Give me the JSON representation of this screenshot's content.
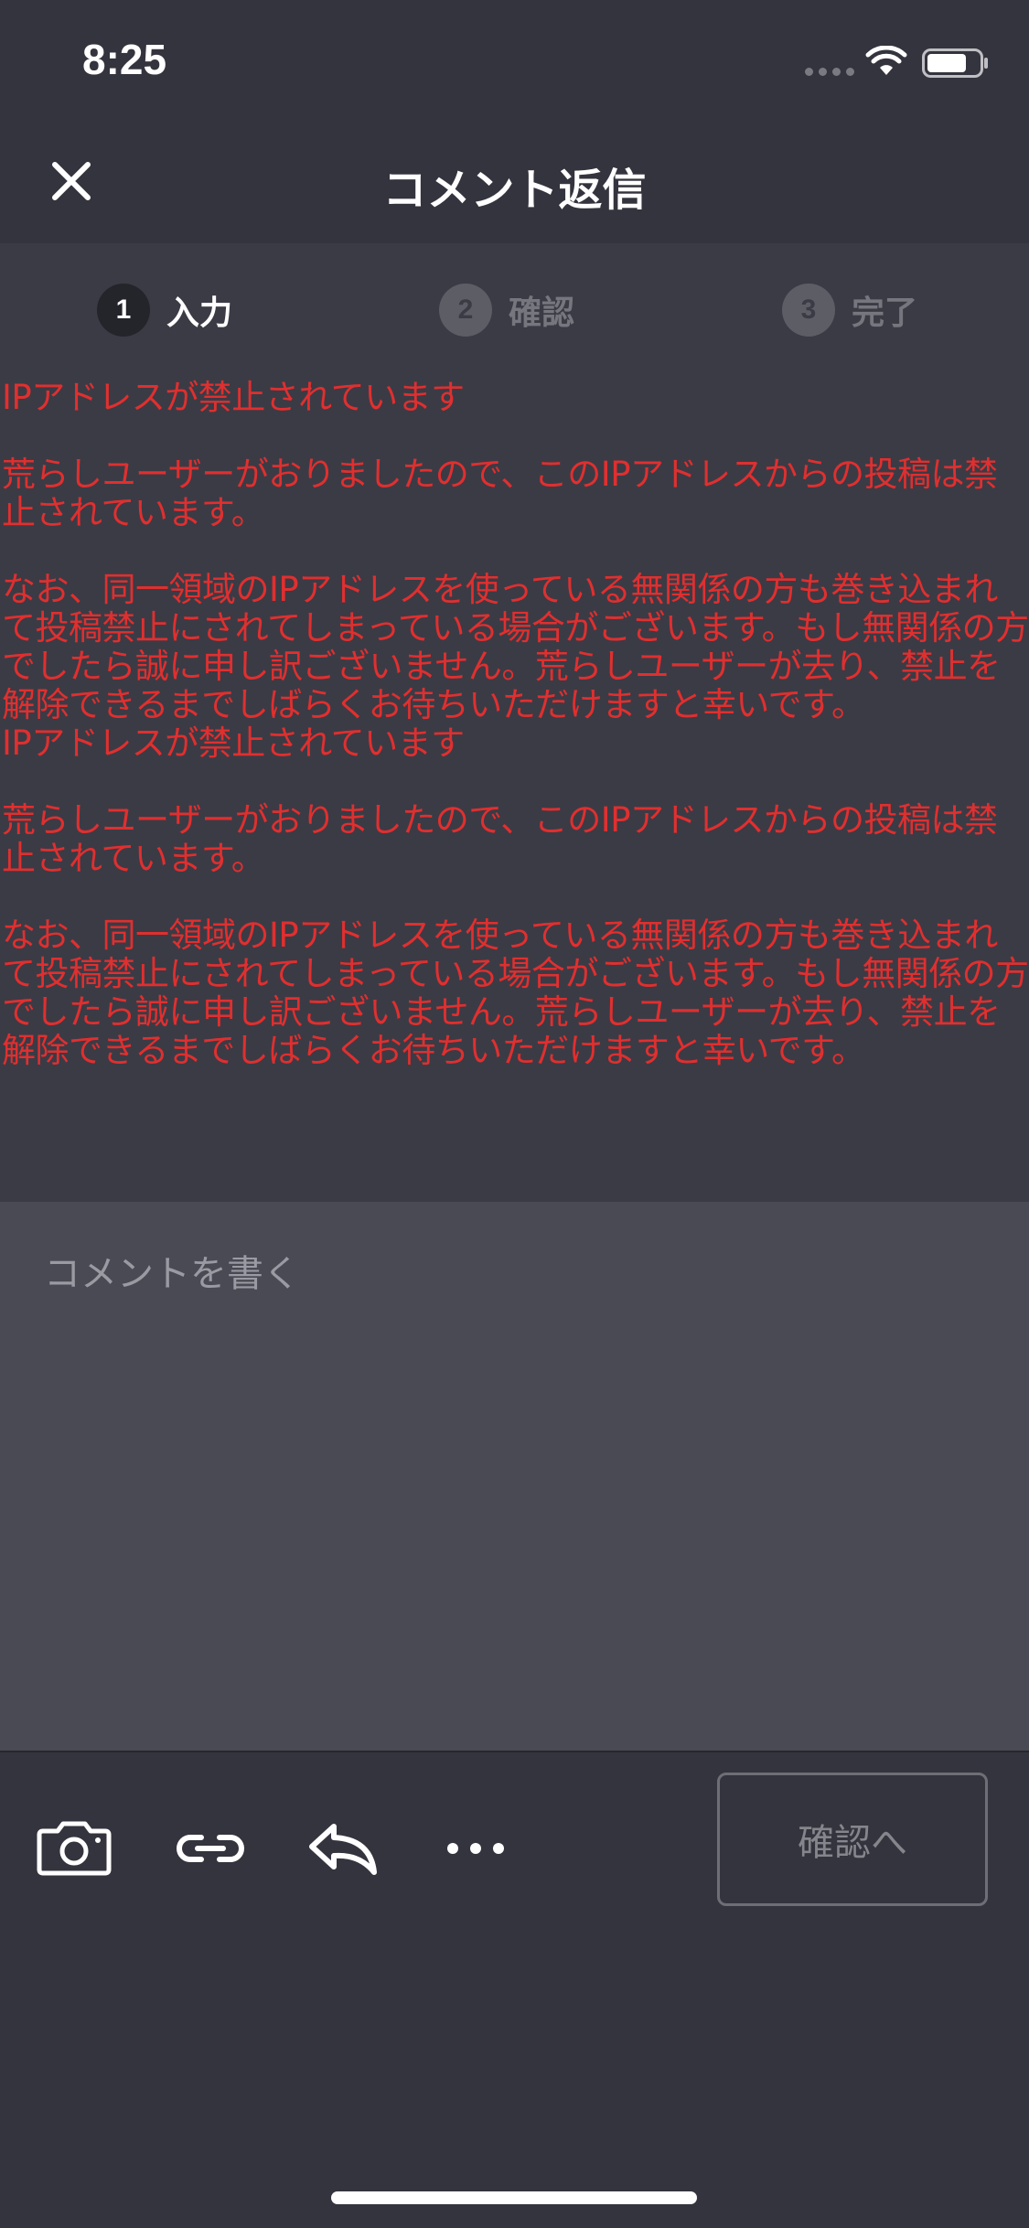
{
  "status_bar": {
    "time": "8:25"
  },
  "nav": {
    "title": "コメント返信",
    "close_icon": "close-icon"
  },
  "steps": [
    {
      "number": "1",
      "label": "入力",
      "active": true
    },
    {
      "number": "2",
      "label": "確認",
      "active": false
    },
    {
      "number": "3",
      "label": "完了",
      "active": false
    }
  ],
  "error": {
    "text": "IPアドレスが禁止されています\n\n荒らしユーザーがおりましたので、このIPアドレスからの投稿は禁止されています。\n\nなお、同一領域のIPアドレスを使っている無関係の方も巻き込まれて投稿禁止にされてしまっている場合がございます。もし無関係の方でしたら誠に申し訳ございません。荒らしユーザーが去り、禁止を解除できるまでしばらくお待ちいただけますと幸いです。\nIPアドレスが禁止されています\n\n荒らしユーザーがおりましたので、このIPアドレスからの投稿は禁止されています。\n\nなお、同一領域のIPアドレスを使っている無関係の方も巻き込まれて投稿禁止にされてしまっている場合がございます。もし無関係の方でしたら誠に申し訳ございません。荒らしユーザーが去り、禁止を解除できるまでしばらくお待ちいただけますと幸いです。",
    "color": "#e02f2f"
  },
  "comment": {
    "value": "",
    "placeholder": "コメントを書く"
  },
  "toolbar": {
    "icons": [
      "camera-icon",
      "link-icon",
      "reply-icon",
      "more-icon"
    ],
    "confirm_label": "確認へ"
  }
}
